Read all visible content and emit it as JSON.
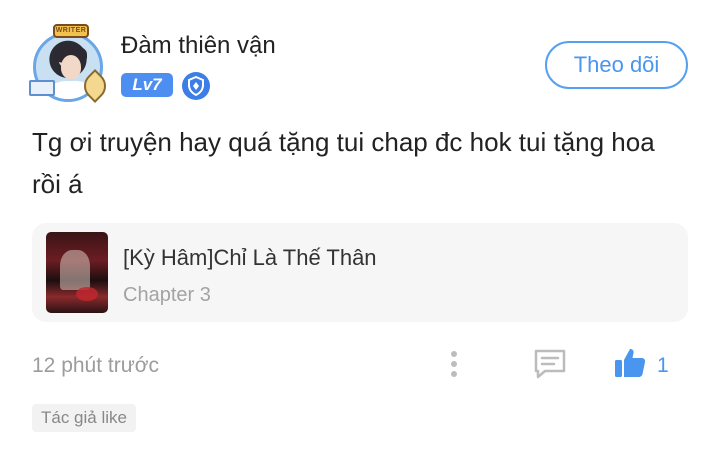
{
  "user": {
    "name": "Đàm thiên vận",
    "level": "Lv7",
    "avatar_badge": "WRITER"
  },
  "follow_label": "Theo dõi",
  "comment": {
    "text": "Tg ơi truyện hay quá tặng tui chap đc hok tui tặng hoa rồi á"
  },
  "story": {
    "title": "[Kỳ Hâm]Chỉ Là Thế Thân",
    "chapter": "Chapter 3"
  },
  "footer": {
    "timestamp": "12 phút trước",
    "like_count": "1",
    "author_like_tag": "Tác giả like"
  },
  "icons": {
    "more": "more-vertical-icon",
    "reply": "reply-comment-icon",
    "like": "thumbs-up-icon",
    "level": "shield-badge-icon"
  },
  "colors": {
    "accent": "#4a95ee",
    "level_badge": "#4d8ff0",
    "muted_text": "#9c9c9c",
    "card_background": "#f6f6f7"
  }
}
